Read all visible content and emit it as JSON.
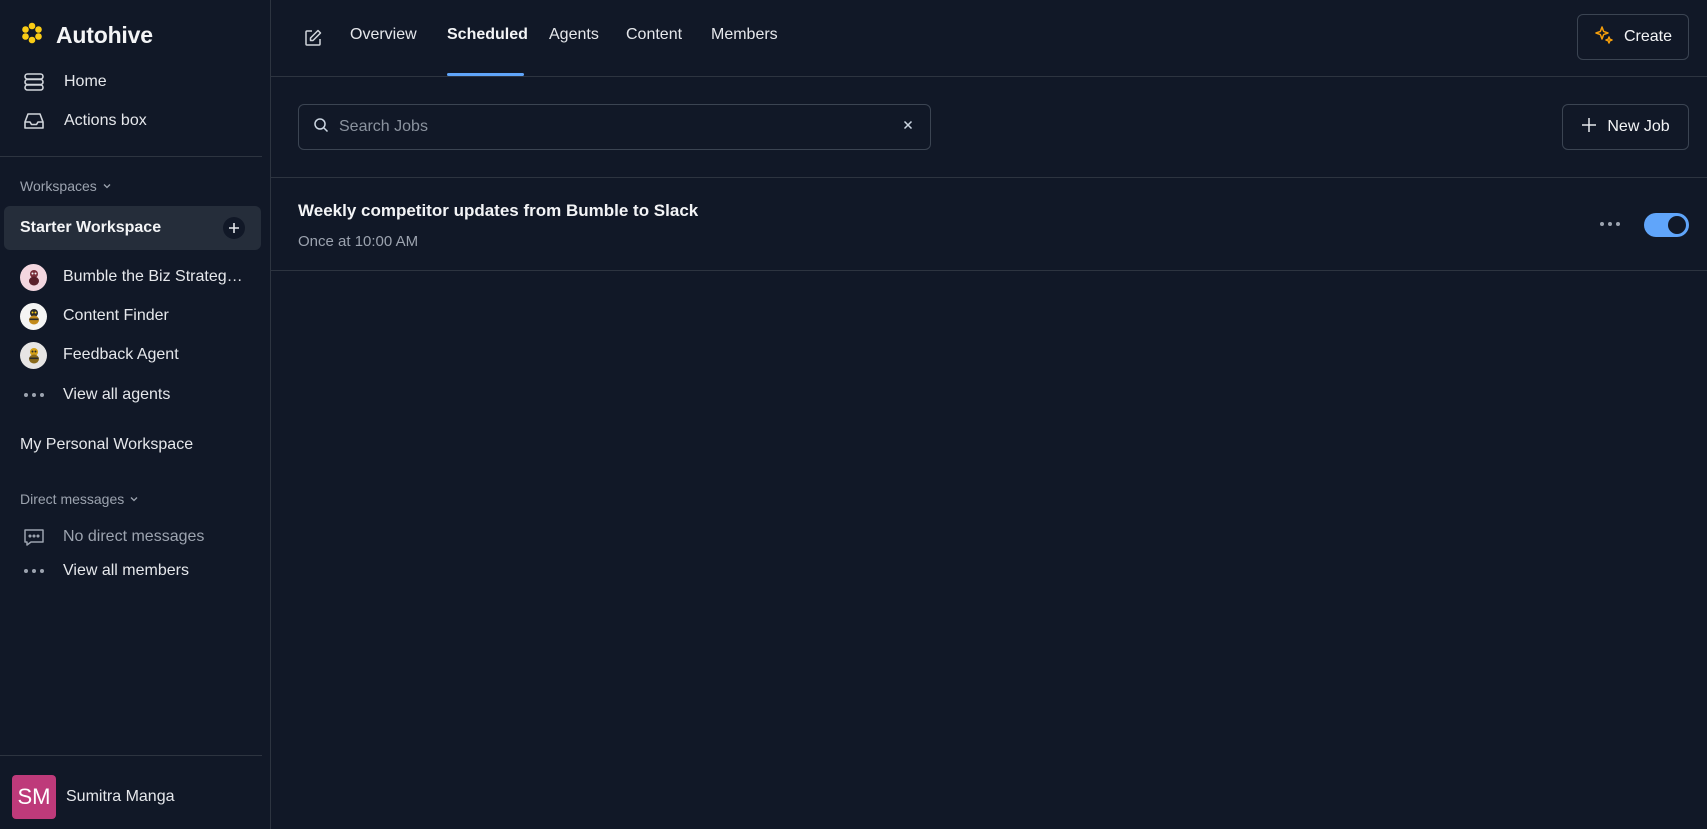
{
  "brand": {
    "name": "Autohive",
    "accent": "#facc15"
  },
  "nav": [
    {
      "label": "Home",
      "icon": "layers-icon"
    },
    {
      "label": "Actions box",
      "icon": "inbox-icon"
    }
  ],
  "workspaces": {
    "label": "Workspaces",
    "active": "Starter Workspace",
    "agents": [
      {
        "label": "Bumble the Biz Strateg…",
        "icon": "bee-avatar-icon"
      },
      {
        "label": "Content Finder",
        "icon": "bee-avatar-icon"
      },
      {
        "label": "Feedback Agent",
        "icon": "bee-avatar-icon"
      }
    ],
    "view_all": "View all agents",
    "personal": "My Personal Workspace"
  },
  "direct_messages": {
    "label": "Direct messages",
    "empty": "No direct messages",
    "view_all": "View all members"
  },
  "user": {
    "initials": "SM",
    "name": "Sumitra Manga",
    "color": "#be3a7a"
  },
  "tabs": [
    "Overview",
    "Scheduled",
    "Agents",
    "Content",
    "Members"
  ],
  "active_tab": "Scheduled",
  "create_label": "Create",
  "search": {
    "placeholder": "Search Jobs"
  },
  "new_job_label": "New Job",
  "jobs": [
    {
      "title": "Weekly competitor updates from Bumble to Slack",
      "schedule": "Once at 10:00 AM",
      "enabled": true
    }
  ]
}
